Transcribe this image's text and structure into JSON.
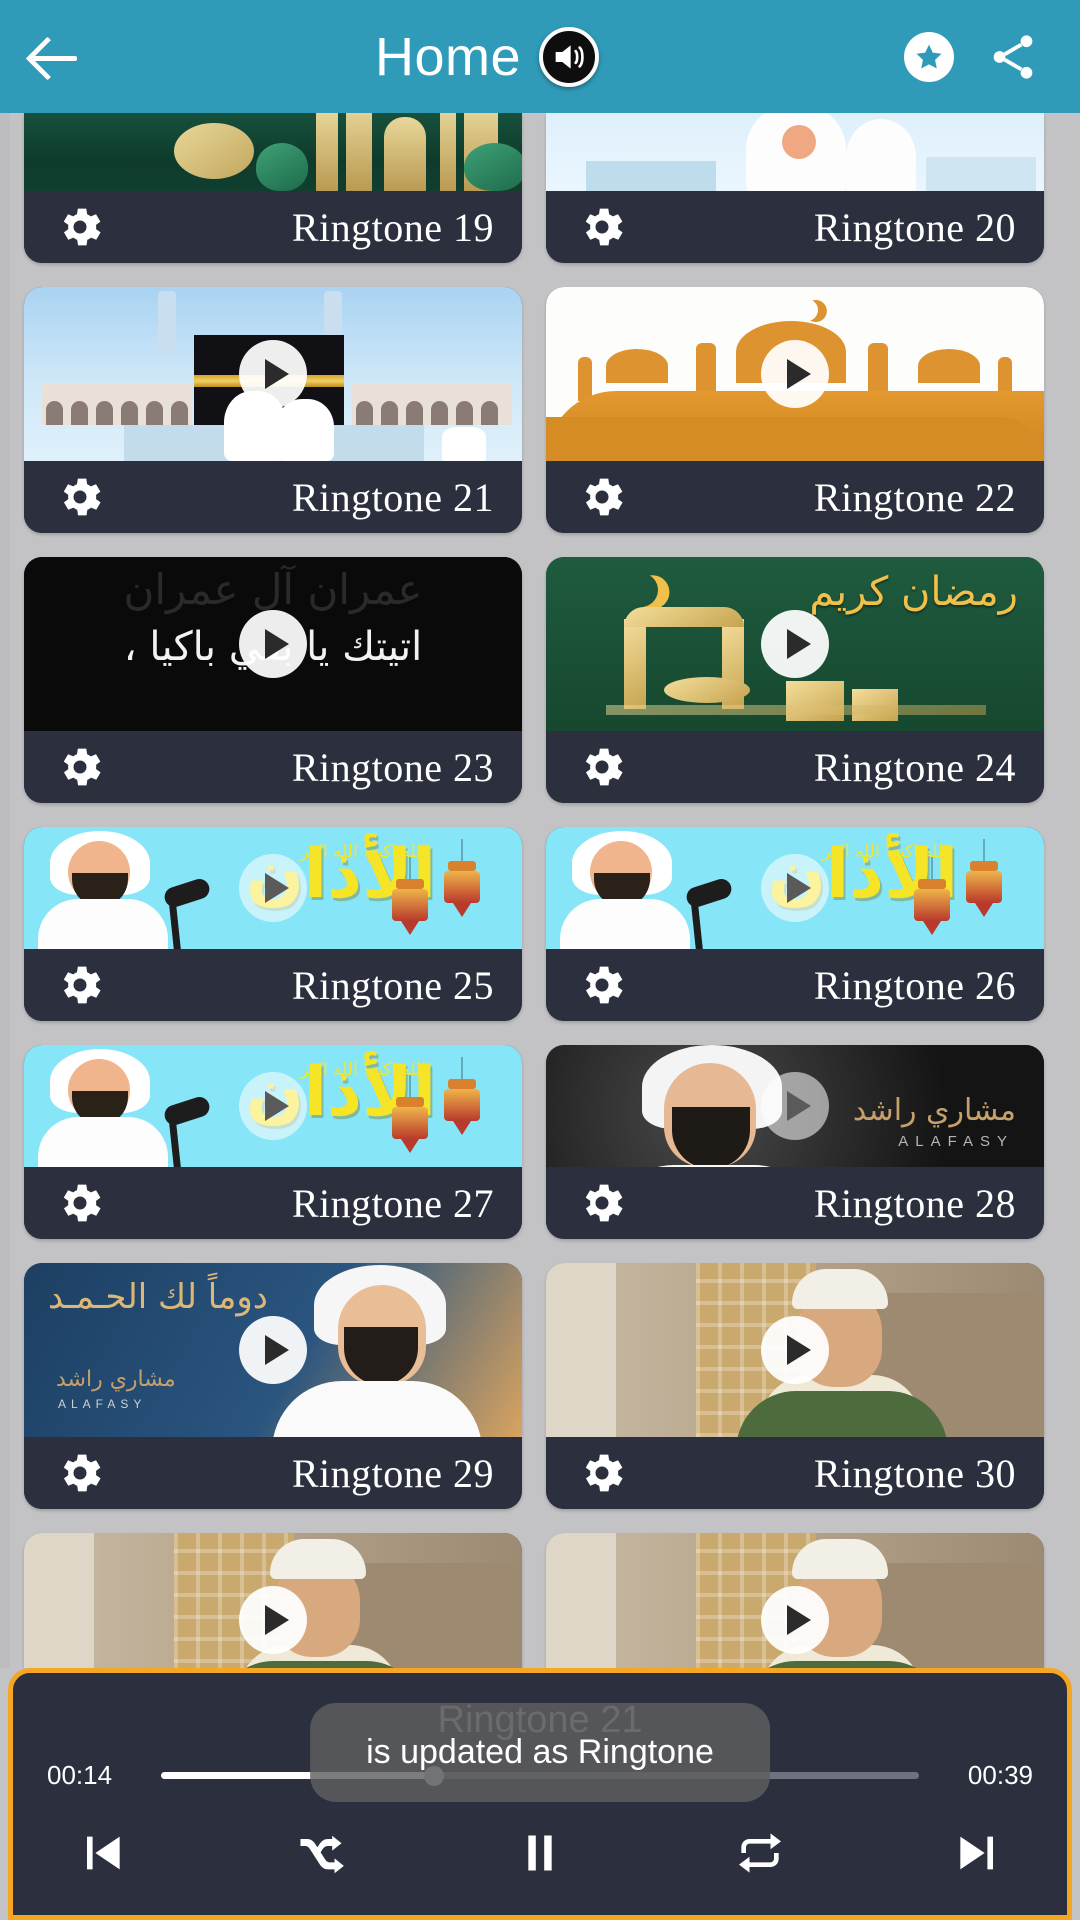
{
  "header": {
    "back_label": "back-arrow",
    "title": "Home",
    "speaker_icon": "speaker-icon",
    "favorite_icon": "star-icon",
    "share_icon": "share-icon"
  },
  "grid": {
    "gear_icon": "gear-icon",
    "play_icon": "play-icon",
    "rows": [
      [
        {
          "label": "Ringtone 19",
          "art": "green-lanterns",
          "partial": true
        },
        {
          "label": "Ringtone 20",
          "art": "sky-person",
          "partial": true
        }
      ],
      [
        {
          "label": "Ringtone 21",
          "art": "kaaba"
        },
        {
          "label": "Ringtone 22",
          "art": "orange-mosque"
        }
      ],
      [
        {
          "label": "Ringtone 23",
          "art": "dark-arabic",
          "caption": "اتيتك يا بقي باكيا ،"
        },
        {
          "label": "Ringtone 24",
          "art": "green-kareem",
          "caption": "رمضان كريم"
        }
      ],
      [
        {
          "label": "Ringtone 25",
          "art": "adhan",
          "caption": "الأذان",
          "caption2": "الله اكبر. الله اكبر"
        },
        {
          "label": "Ringtone 26",
          "art": "adhan",
          "caption": "الأذان",
          "caption2": "الله اكبر. الله اكبر"
        }
      ],
      [
        {
          "label": "Ringtone 27",
          "art": "adhan",
          "caption": "الأذان",
          "caption2": "الله اكبر. الله اكبر"
        },
        {
          "label": "Ringtone 28",
          "art": "alafasy-dark",
          "caption": "مشاري راشد",
          "caption2": "ALAFASY"
        }
      ],
      [
        {
          "label": "Ringtone 29",
          "art": "alafasy-blue",
          "caption": "دوماً لك الحـمـد",
          "caption2": "ALAFASY"
        },
        {
          "label": "Ringtone 30",
          "art": "reciter-room"
        }
      ],
      [
        {
          "label": "",
          "art": "reciter-room",
          "partial_bottom": true
        },
        {
          "label": "",
          "art": "reciter-room",
          "partial_bottom": true
        }
      ]
    ]
  },
  "player": {
    "track_title": "Ringtone 21",
    "elapsed": "00:14",
    "duration": "00:39",
    "progress_percent": 36,
    "accent_color": "#f5a623",
    "controls": [
      {
        "name": "previous",
        "icon": "skip-previous-icon"
      },
      {
        "name": "shuffle",
        "icon": "shuffle-icon"
      },
      {
        "name": "play-pause",
        "icon": "pause-icon"
      },
      {
        "name": "repeat",
        "icon": "repeat-icon"
      },
      {
        "name": "next",
        "icon": "skip-next-icon"
      }
    ]
  },
  "toast": {
    "message": "is updated as Ringtone"
  }
}
